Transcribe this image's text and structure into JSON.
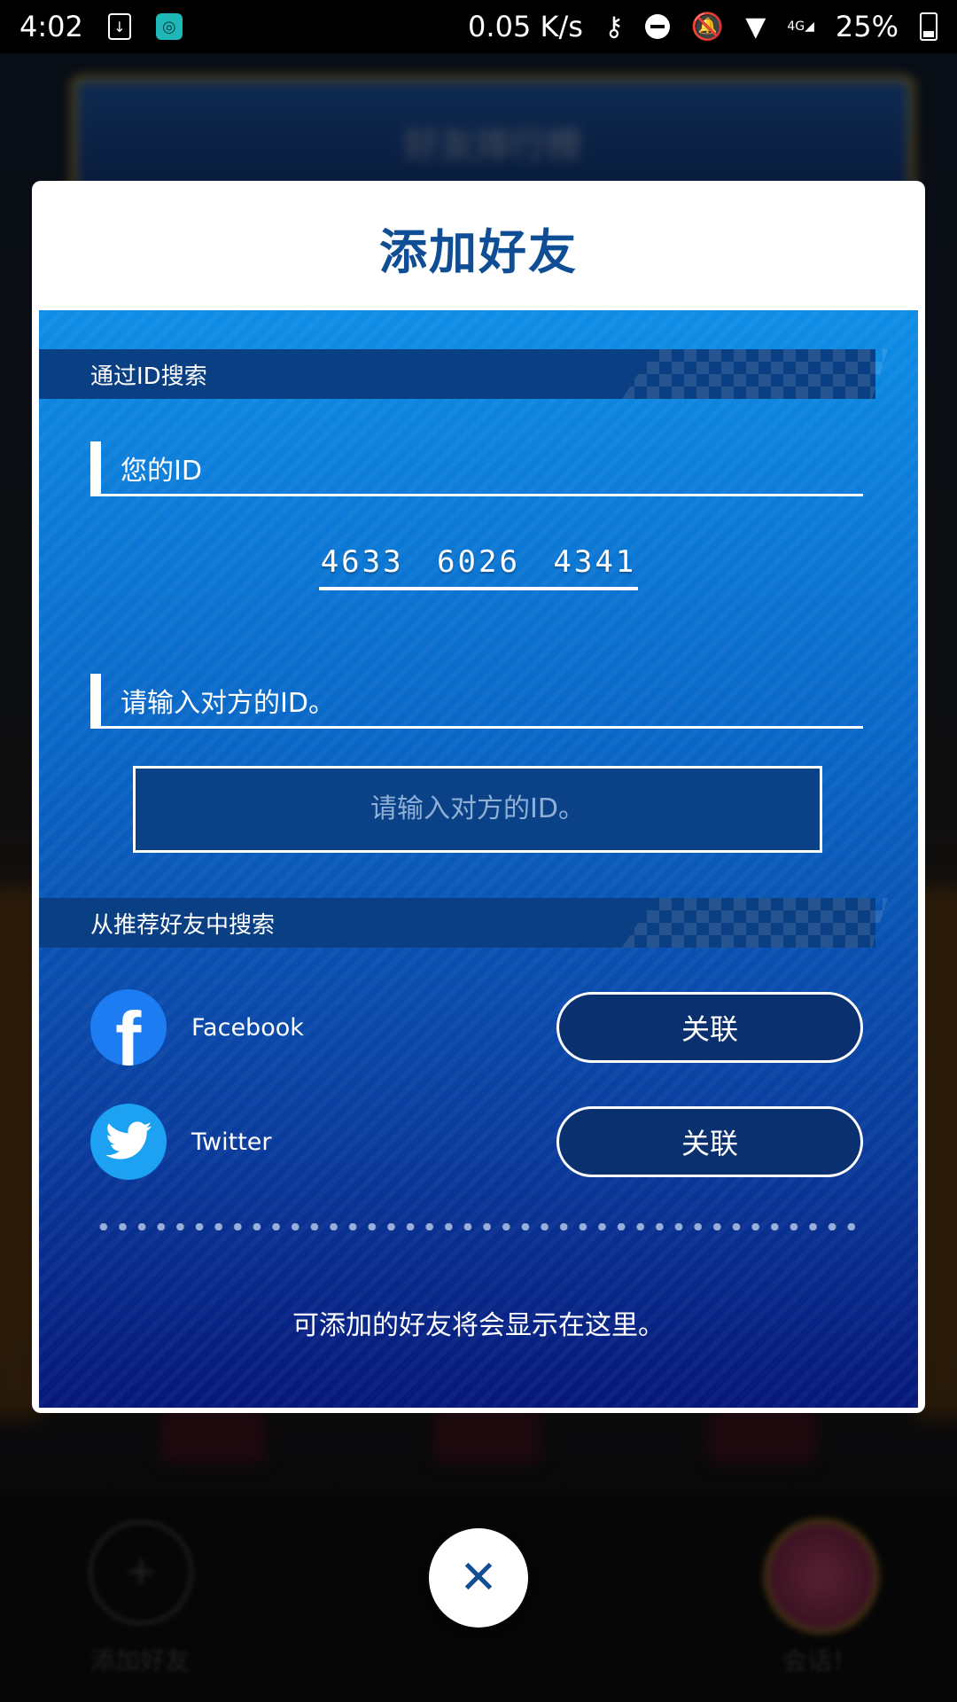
{
  "status_bar": {
    "time": "4:02",
    "net_speed": "0.05 K/s",
    "battery": "25%",
    "network_label": "4G"
  },
  "background": {
    "banner_text": "好友排行榜",
    "add_friend_label": "添加好友",
    "avatar_label": "会话！"
  },
  "dialog": {
    "title": "添加好友",
    "search_by_id_header": "通过ID搜索",
    "your_id_label": "您的ID",
    "your_id_value": "4633  6026  4341",
    "enter_id_label": "请输入对方的ID。",
    "id_input_placeholder": "请输入对方的ID。",
    "recommend_header": "从推荐好友中搜索",
    "social": [
      {
        "name": "Facebook",
        "button_label": "关联",
        "icon": "facebook-icon",
        "color": "#1d7cf2"
      },
      {
        "name": "Twitter",
        "button_label": "关联",
        "icon": "twitter-icon",
        "color": "#1da1f2"
      }
    ],
    "empty_message": "可添加的好友将会显示在这里。"
  },
  "close_button": {
    "glyph": "✕"
  },
  "colors": {
    "title": "#0f4e94",
    "panel_top": "#0f8de6",
    "panel_bottom": "#06187a",
    "section_header": "#0b3f84"
  }
}
